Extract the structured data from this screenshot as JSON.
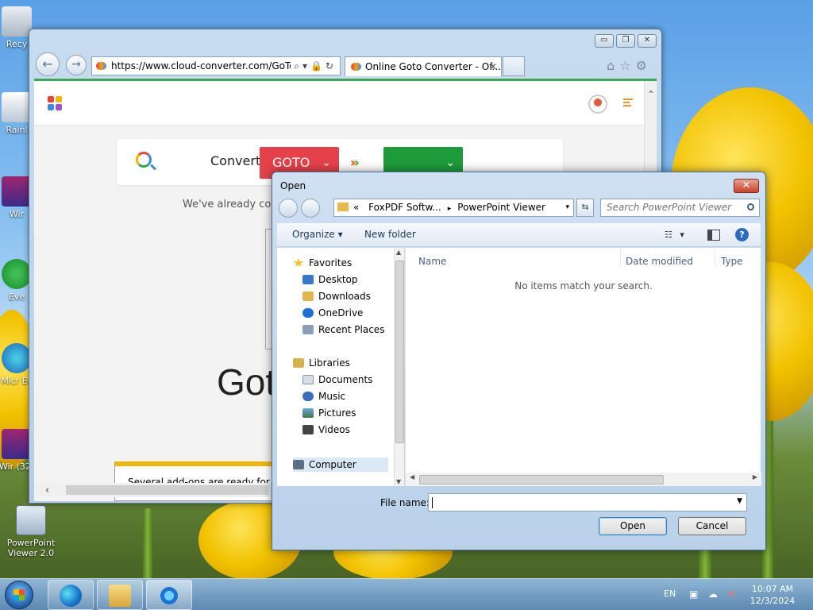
{
  "desktop": {
    "icons": [
      {
        "label": "Recy"
      },
      {
        "label": "Rainl"
      },
      {
        "label": "Wir"
      },
      {
        "label": "Eve"
      },
      {
        "label": "Micr Ec"
      },
      {
        "label": "Wir (32)"
      },
      {
        "label": "PowerPoint Viewer 2.0"
      }
    ]
  },
  "browser": {
    "address_url": "https://www.cloud-converter.com/GoTo",
    "address_tools": "⌕▾🔒↻",
    "tab_title": "Online Goto Converter - Of...",
    "tab_close": "✕",
    "caption_minimize": "▭",
    "caption_restore": "❐",
    "caption_close": "✕",
    "back_glyph": "←",
    "forward_glyph": "→",
    "page": {
      "convert_label": "Convert",
      "from_format": "GOTO",
      "chevron": "⌄",
      "arrows": [
        "›",
        "›",
        "›"
      ],
      "to_format": "",
      "already_text": "We've already conve",
      "big_title": "Got",
      "notification": "Several add-ons are ready for use.",
      "scroll_left": "‹",
      "scroll_up": "⌃"
    }
  },
  "dialog": {
    "title": "Open",
    "close_glyph": "✕",
    "breadcrumb": {
      "prefix": "«",
      "parent": "FoxPDF Softw...",
      "separator": "▸",
      "current": "PowerPoint Viewer",
      "dropdown": "▾"
    },
    "refresh_glyph": "⇆",
    "search_placeholder": "Search PowerPoint Viewer",
    "toolbar": {
      "organize_label": "Organize ▾",
      "new_folder_label": "New folder",
      "view_glyph": "☷ ▾",
      "help_glyph": "?"
    },
    "nav": {
      "favorites": "Favorites",
      "items_favorites": [
        "Desktop",
        "Downloads",
        "OneDrive",
        "Recent Places"
      ],
      "libraries": "Libraries",
      "items_libraries": [
        "Documents",
        "Music",
        "Pictures",
        "Videos"
      ],
      "computer": "Computer"
    },
    "columns": [
      "Name",
      "Date modified",
      "Type"
    ],
    "empty_message": "No items match your search.",
    "file_name_label": "File name:",
    "file_name_value": "",
    "open_label": "Open",
    "cancel_label": "Cancel"
  },
  "taskbar": {
    "language": "EN",
    "time": "10:07 AM",
    "date": "12/3/2024"
  }
}
